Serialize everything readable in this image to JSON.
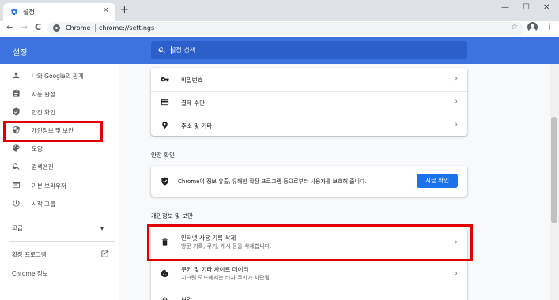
{
  "tab": {
    "title": "설정",
    "close": "✕",
    "new_tab": "+"
  },
  "window": {
    "minimize": "—",
    "maximize": "☐",
    "close": "✕"
  },
  "toolbar": {
    "back": "←",
    "forward": "→",
    "reload": "C",
    "site_label": "Chrome",
    "url": "chrome://settings",
    "star": "☆",
    "menu": "⋮"
  },
  "header": {
    "title": "설정",
    "search_placeholder": "설정 검색"
  },
  "sidebar": {
    "items": [
      {
        "label": "나와 Google의 관계",
        "icon": "person-icon"
      },
      {
        "label": "자동 완성",
        "icon": "clipboard-icon"
      },
      {
        "label": "안전 확인",
        "icon": "shield-check-icon"
      },
      {
        "label": "개인정보 및 보안",
        "icon": "shield-icon"
      },
      {
        "label": "모양",
        "icon": "palette-icon"
      },
      {
        "label": "검색엔진",
        "icon": "search-icon"
      },
      {
        "label": "기본 브라우저",
        "icon": "browser-icon"
      },
      {
        "label": "시작 그룹",
        "icon": "power-icon"
      }
    ],
    "advanced": "고급",
    "advanced_chevron": "▾",
    "extensions": "확장 프로그램",
    "about": "Chrome 정보"
  },
  "autofill_card": {
    "rows": [
      {
        "label": "비밀번호",
        "icon": "key-icon"
      },
      {
        "label": "결제 수단",
        "icon": "credit-card-icon"
      },
      {
        "label": "주소 및 기타",
        "icon": "location-pin-icon"
      }
    ]
  },
  "safety": {
    "section_title": "안전 확인",
    "message": "Chrome이 정보 유출, 유해한 확장 프로그램 등으로부터 사용자를 보호해 줍니다.",
    "button": "지금 확인"
  },
  "privacy": {
    "section_title": "개인정보 및 보안",
    "rows": [
      {
        "label": "인터넷 사용 기록 삭제",
        "sub": "방문 기록, 쿠키, 캐시 등을 삭제합니다.",
        "icon": "trash-icon"
      },
      {
        "label": "쿠키 및 기타 사이트 데이터",
        "sub": "시크릿 모드에서는 타사 쿠키가 차단됨",
        "icon": "cookie-icon"
      },
      {
        "label": "보안",
        "icon": "lock-icon"
      }
    ]
  },
  "colors": {
    "header_blue": "#3c73de",
    "button_blue": "#1a73e8",
    "highlight_red": "#e00000"
  },
  "arrow": "›"
}
